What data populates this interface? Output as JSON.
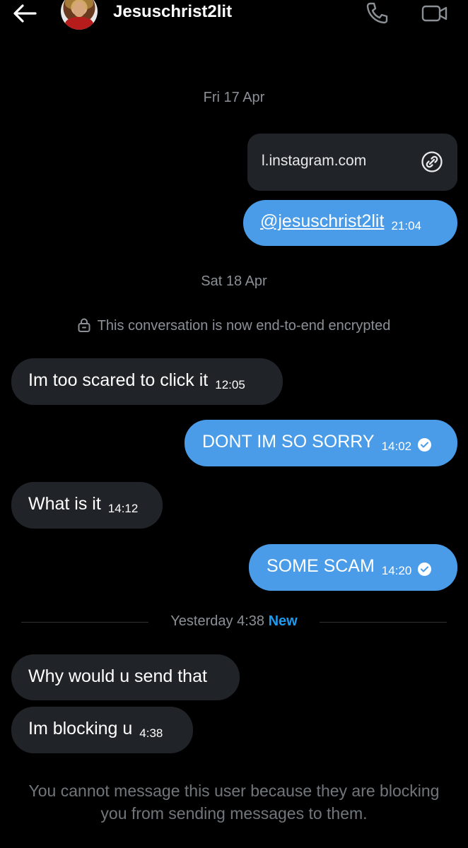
{
  "header": {
    "username": "Jesuschrist2lit",
    "icons": {
      "back": "arrow-left-icon",
      "call": "phone-icon",
      "video": "video-camera-icon"
    }
  },
  "dates": {
    "first": "Fri 17 Apr",
    "second": "Sat 18 Apr"
  },
  "link_card": {
    "text": "l.instagram.com",
    "icon": "link-icon"
  },
  "messages": [
    {
      "text": "@jesuschrist2lit",
      "time": "21:04",
      "direction": "out"
    },
    {
      "text": "Im too scared to click it",
      "time": "12:05",
      "direction": "in"
    },
    {
      "text": "DONT IM SO SORRY",
      "time": "14:02",
      "direction": "out",
      "read": true
    },
    {
      "text": "What is it",
      "time": "14:12",
      "direction": "in"
    },
    {
      "text": "SOME SCAM",
      "time": "14:20",
      "direction": "out",
      "read": true
    },
    {
      "text": "Why would u send that",
      "time": "",
      "direction": "in"
    },
    {
      "text": "Im blocking u",
      "time": "4:38",
      "direction": "in"
    }
  ],
  "encryption_notice": "This conversation is now end-to-end encrypted",
  "new_separator": {
    "label": "Yesterday 4:38",
    "badge": "New"
  },
  "blocked_notice": "You cannot message this user because they are blocking you from sending messages to them.",
  "colors": {
    "outgoing": "#4a9ce8",
    "incoming": "#202327",
    "accent": "#1d9bf0",
    "background": "#000000"
  }
}
